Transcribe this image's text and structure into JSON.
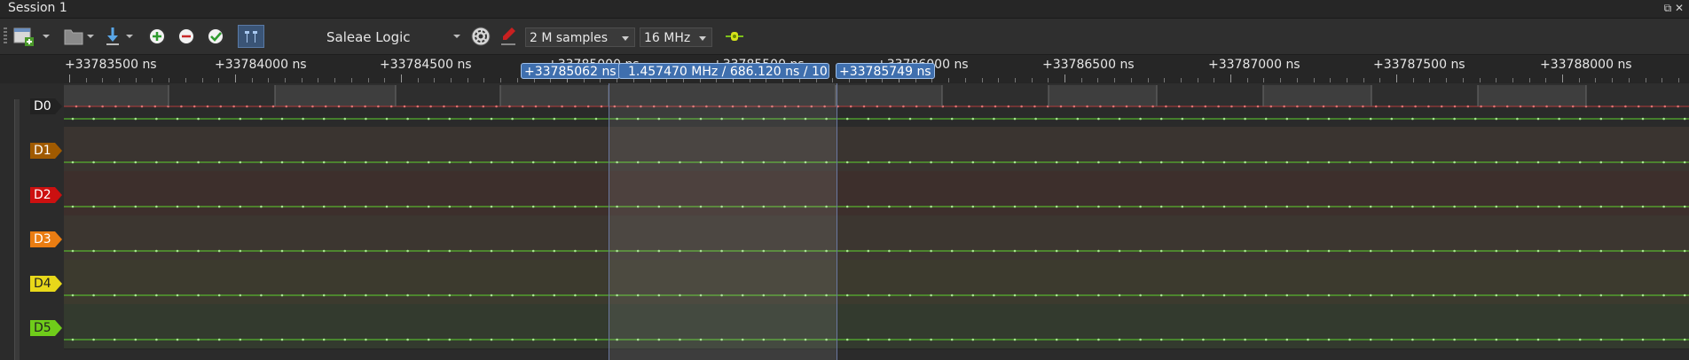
{
  "window": {
    "title": "Session 1",
    "window_controls": "⧉ ✕"
  },
  "toolbar": {
    "device": "Saleae Logic",
    "samples": "2 M samples",
    "rate": "16 MHz"
  },
  "ruler": {
    "ticks": [
      "+33783500 ns",
      "+33784000 ns",
      "+33784500 ns",
      "+33785000 ns",
      "+33785500 ns",
      "+33786000 ns",
      "+33786500 ns",
      "+33787000 ns",
      "+33787500 ns",
      "+33788000 ns"
    ],
    "marker1": "+33785062 ns",
    "measurement": "1.457470 MHz / 686.120 ns / 10",
    "marker2": "+33785749 ns"
  },
  "channels": [
    {
      "name": "D0",
      "color": "#222222",
      "text_color": "#ffffff"
    },
    {
      "name": "D1",
      "color": "#a05a00",
      "text_color": "#ffffff"
    },
    {
      "name": "D2",
      "color": "#cc1010",
      "text_color": "#ffffff"
    },
    {
      "name": "D3",
      "color": "#ea7d12",
      "text_color": "#ffffff"
    },
    {
      "name": "D4",
      "color": "#e8d81a",
      "text_color": "#222222"
    },
    {
      "name": "D5",
      "color": "#6fcc1a",
      "text_color": "#222222"
    }
  ],
  "colors": {
    "signal_green": "#5ed12e",
    "signal_red": "#b23a3a",
    "selection_border": "#6a78a0"
  }
}
